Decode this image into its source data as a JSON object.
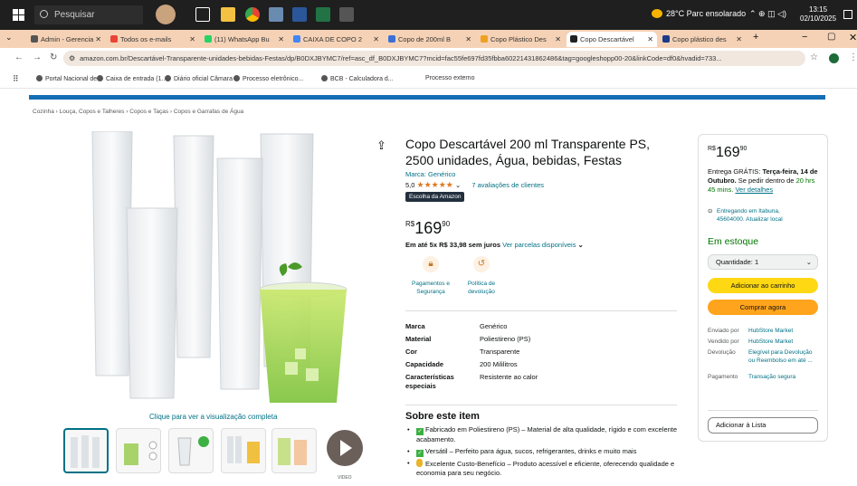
{
  "taskbar": {
    "search_placeholder": "Pesquisar",
    "weather": "28°C  Parc ensolarado",
    "time": "13:15",
    "date": "02/10/2025"
  },
  "tabs": [
    {
      "label": "Admin - Gerencia",
      "color": "#555"
    },
    {
      "label": "Todos os e-mails",
      "color": "#ea4335"
    },
    {
      "label": "(11) WhatsApp Bu",
      "color": "#25d366"
    },
    {
      "label": "CAIXA DE COPO 2",
      "color": "#4285f4"
    },
    {
      "label": "Copo de 200ml B",
      "color": "#3b6fd8"
    },
    {
      "label": "Copo Plástico Des",
      "color": "#f0a020"
    },
    {
      "label": "Copo Descartável",
      "color": "#222"
    },
    {
      "label": "Copo plástico des",
      "color": "#1a3a8a"
    }
  ],
  "address": {
    "url": "amazon.com.br/Descartável-Transparente-unidades-bebidas-Festas/dp/B0DXJBYMC7/ref=asc_df_B0DXJBYMC7?mcid=fac55fe697fd35fbba60221431862486&tag=googleshopp00-20&linkCode=df0&hvadid=733..."
  },
  "bookmarks": [
    "Portal Nacional de...",
    "Caixa de entrada (1...",
    "Diário oficial Câmara",
    "Processo eletrônico...",
    "BCB - Calculadora d...",
    "Processo externo"
  ],
  "breadcrumb": "Cozinha › Louça, Copos e Talheres › Copos e Taças › Copos e Garrafas de Água",
  "gallery": {
    "view_full": "Clique para ver a visualização completa",
    "video_label": "VIDEO"
  },
  "product": {
    "title": "Copo Descartável 200 ml Transparente PS, 2500 unidades, Água, bebidas, Festas",
    "brand": "Marca: Genérico",
    "rating_value": "5,0",
    "stars": "★★★★★",
    "ratings_count": "7 avaliações de clientes",
    "choice_badge": "Escolha da Amazon",
    "price_currency": "R$",
    "price_whole": "169",
    "price_cents": "90",
    "installments": "Em até 5x R$ 33,98 sem juros",
    "installments_link": "Ver parcelas disponíveis",
    "badges": [
      {
        "label": "Pagamentos e Segurança",
        "icon": "lock-icon"
      },
      {
        "label": "Política de devolução",
        "icon": "return-icon"
      }
    ],
    "specs": [
      {
        "key": "Marca",
        "value": "Genérico"
      },
      {
        "key": "Material",
        "value": "Poliestireno (PS)"
      },
      {
        "key": "Cor",
        "value": "Transparente"
      },
      {
        "key": "Capacidade",
        "value": "200 Mililitros"
      },
      {
        "key": "Características especiais",
        "value": "Resistente ao calor"
      }
    ],
    "about_title": "Sobre este item",
    "about_items": [
      "Fabricado em Poliestireno (PS) – Material de alta qualidade, rígido e com excelente acabamento.",
      "Versátil – Perfeito para água, sucos, refrigerantes, drinks e muito mais",
      "Excelente Custo-Benefício – Produto acessível e eficiente, oferecendo qualidade e economia para seu negócio."
    ]
  },
  "buybox": {
    "currency": "R$",
    "price_whole": "169",
    "price_cents": "90",
    "delivery_prefix": "Entrega GRÁTIS: ",
    "delivery_date": "Terça-feira, 14 de Outubro.",
    "delivery_mid": " Se pedir dentro de ",
    "delivery_time": "20 hrs 45 mins.",
    "delivery_link": "Ver detalhes",
    "location": "Entregando em Itabuna, 45604000. Atualizar local",
    "stock": "Em estoque",
    "quantity": "Quantidade: 1",
    "add_to_cart": "Adicionar ao carrinho",
    "buy_now": "Comprar agora",
    "info": [
      {
        "key": "Enviado por",
        "value": "HubStore Market"
      },
      {
        "key": "Vendido por",
        "value": "HubStore Market"
      },
      {
        "key": "Devolução",
        "value": "Elegível para Devolução ou Reembolso em até ..."
      },
      {
        "key": "Pagamento",
        "value": "Transação segura"
      }
    ],
    "add_to_list": "Adicionar à Lista"
  },
  "colors": {
    "link": "#007185",
    "cart_button": "#ffd814",
    "buy_button": "#ffa41c",
    "stars": "#de7921",
    "in_stock": "#007600"
  }
}
